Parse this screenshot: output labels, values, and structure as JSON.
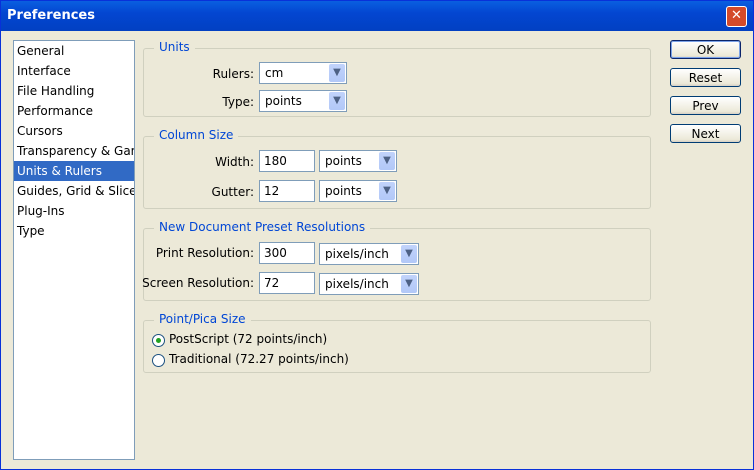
{
  "window": {
    "title": "Preferences",
    "close_glyph": "✕"
  },
  "categories": [
    {
      "label": "General",
      "selected": false
    },
    {
      "label": "Interface",
      "selected": false
    },
    {
      "label": "File Handling",
      "selected": false
    },
    {
      "label": "Performance",
      "selected": false
    },
    {
      "label": "Cursors",
      "selected": false
    },
    {
      "label": "Transparency & Gamut",
      "selected": false
    },
    {
      "label": "Units & Rulers",
      "selected": true
    },
    {
      "label": "Guides, Grid & Slices",
      "selected": false
    },
    {
      "label": "Plug-Ins",
      "selected": false
    },
    {
      "label": "Type",
      "selected": false
    }
  ],
  "units": {
    "legend": "Units",
    "rulers_label": "Rulers:",
    "rulers_value": "cm",
    "type_label": "Type:",
    "type_value": "points"
  },
  "column_size": {
    "legend": "Column Size",
    "width_label": "Width:",
    "width_value": "180",
    "width_unit": "points",
    "gutter_label": "Gutter:",
    "gutter_value": "12",
    "gutter_unit": "points"
  },
  "resolutions": {
    "legend": "New Document Preset Resolutions",
    "print_label": "Print Resolution:",
    "print_value": "300",
    "print_unit": "pixels/inch",
    "screen_label": "Screen Resolution:",
    "screen_value": "72",
    "screen_unit": "pixels/inch"
  },
  "point_pica": {
    "legend": "Point/Pica Size",
    "options": [
      {
        "label": "PostScript (72 points/inch)",
        "checked": true
      },
      {
        "label": "Traditional (72.27 points/inch)",
        "checked": false
      }
    ]
  },
  "buttons": {
    "ok": "OK",
    "reset": "Reset",
    "prev": "Prev",
    "next": "Next"
  },
  "colors": {
    "titlebar": "#0346d1",
    "selection": "#316ac5",
    "legend_text": "#0046d5",
    "dialog_bg": "#ece9d8"
  }
}
